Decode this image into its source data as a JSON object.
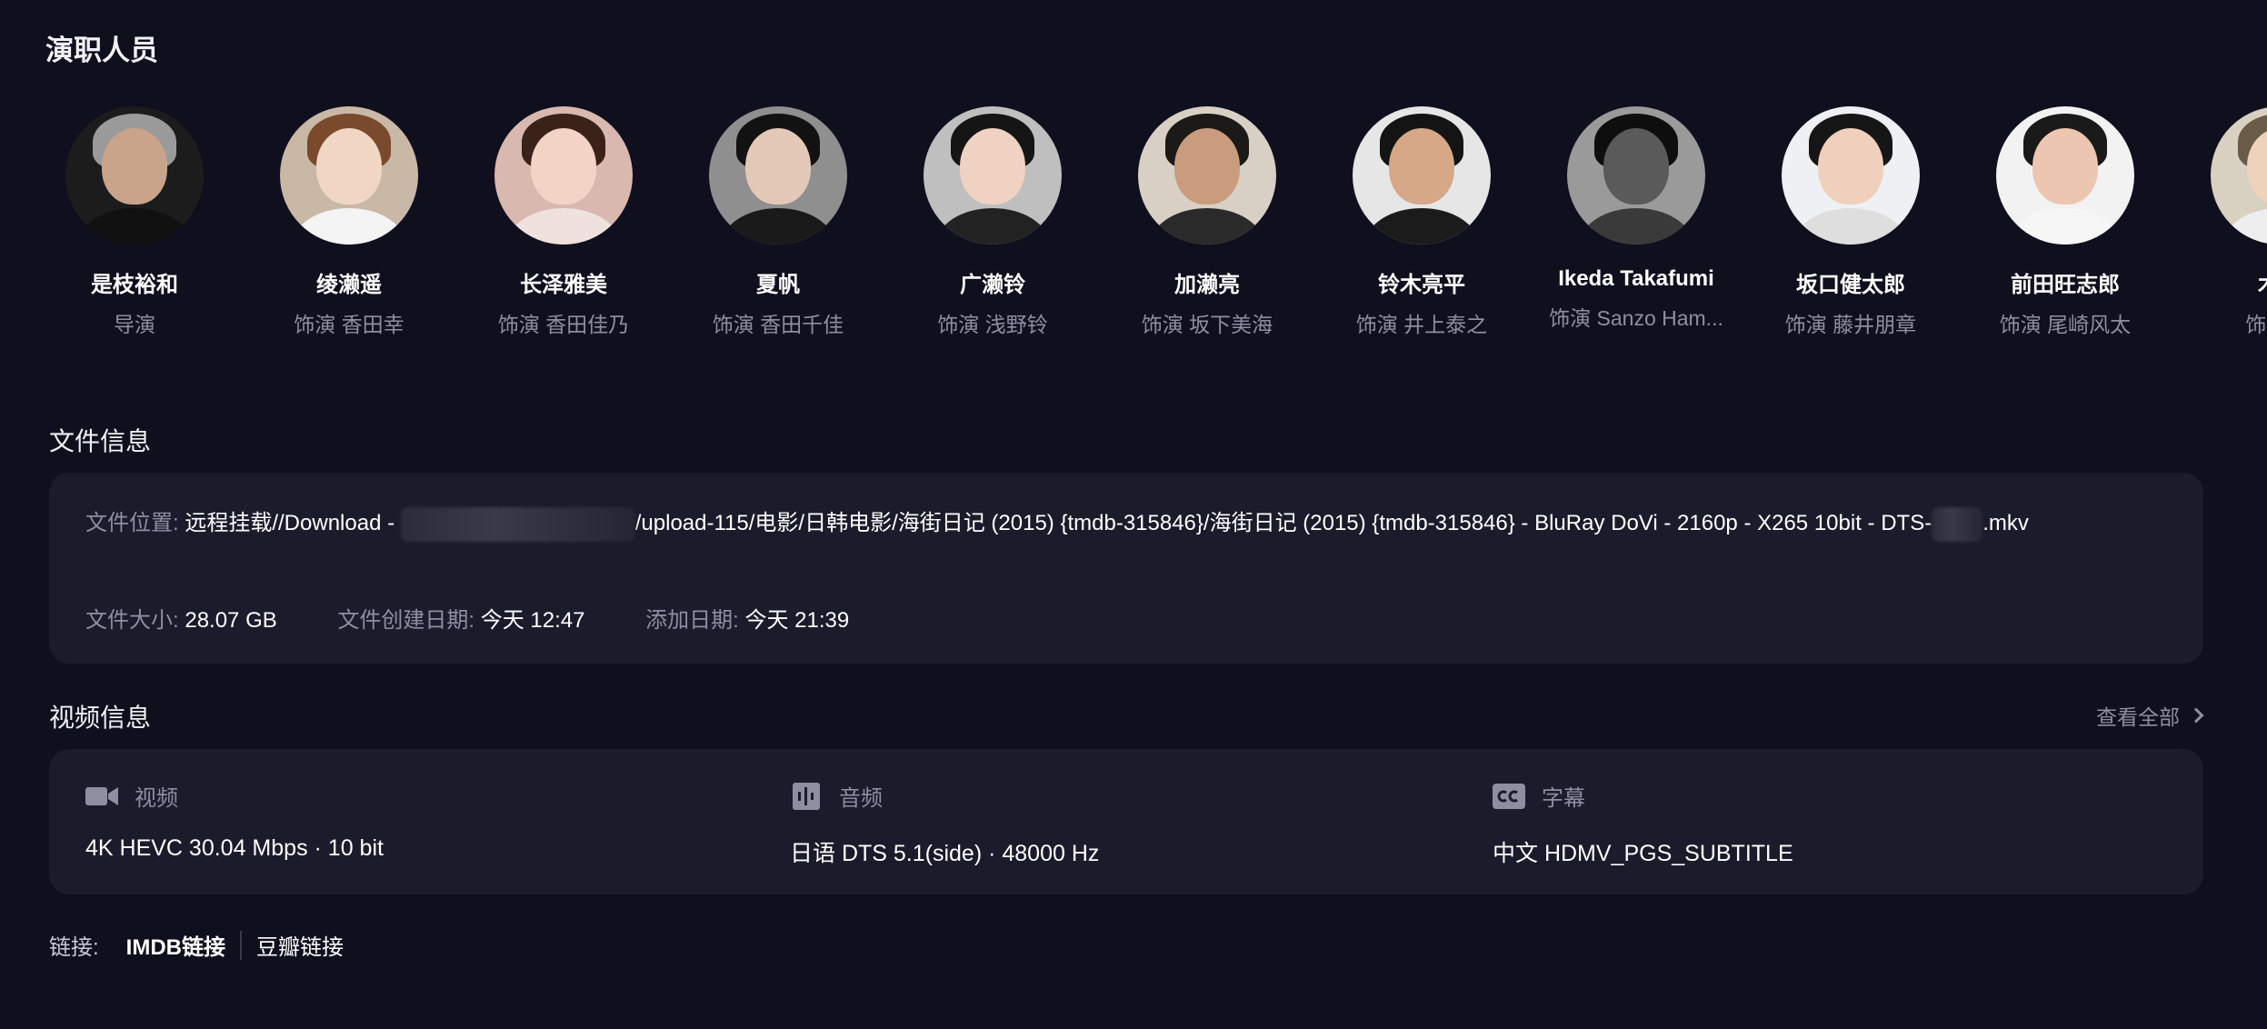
{
  "cast": {
    "title": "演职人员",
    "members": [
      {
        "name": "是枝裕和",
        "role": "导演"
      },
      {
        "name": "绫濑遥",
        "role": "饰演 香田幸"
      },
      {
        "name": "长泽雅美",
        "role": "饰演 香田佳乃"
      },
      {
        "name": "夏帆",
        "role": "饰演 香田千佳"
      },
      {
        "name": "广濑铃",
        "role": "饰演 浅野铃"
      },
      {
        "name": "加濑亮",
        "role": "饰演 坂下美海"
      },
      {
        "name": "铃木亮平",
        "role": "饰演 井上泰之"
      },
      {
        "name": "Ikeda Takafumi",
        "role": "饰演 Sanzo Ham..."
      },
      {
        "name": "坂口健太郎",
        "role": "饰演 藤井朋章"
      },
      {
        "name": "前田旺志郎",
        "role": "饰演 尾崎风太"
      },
      {
        "name": "木村",
        "role": "饰演 高"
      }
    ]
  },
  "file_info": {
    "title": "文件信息",
    "path_label": "文件位置:",
    "path_prefix": "远程挂载//Download - ",
    "path_middle": "/upload-115/电影/日韩电影/海街日记 (2015) {tmdb-315846}/海街日记 (2015) {tmdb-315846} - BluRay DoVi - 2160p - X265 10bit - DTS-",
    "path_suffix": ".mkv",
    "size_label": "文件大小:",
    "size_value": "28.07 GB",
    "created_label": "文件创建日期:",
    "created_value": "今天 12:47",
    "added_label": "添加日期:",
    "added_value": "今天 21:39"
  },
  "video_info": {
    "title": "视频信息",
    "view_all": "查看全部",
    "video_label": "视频",
    "video_value": "4K HEVC 30.04 Mbps · 10 bit",
    "audio_label": "音频",
    "audio_value": "日语 DTS 5.1(side) · 48000 Hz",
    "subtitle_label": "字幕",
    "subtitle_value": "中文 HDMV_PGS_SUBTITLE"
  },
  "links": {
    "label": "链接:",
    "imdb": "IMDB链接",
    "douban": "豆瓣链接"
  },
  "colors": {
    "background": "#0f0f1e",
    "card": "#1b1b2b",
    "muted_text": "#8d8fa1"
  }
}
